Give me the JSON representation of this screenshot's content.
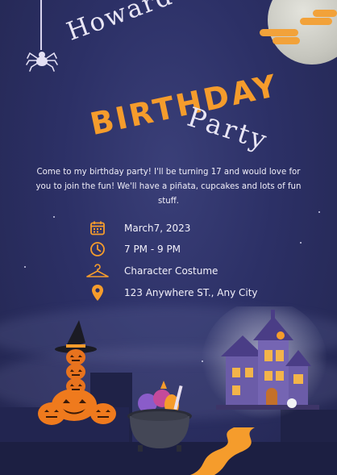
{
  "invite": {
    "name_line": "Howard's",
    "headline": "BIRTHDAY",
    "subline": "Party",
    "message": "Come to my birthday party! I'll be turning 17 and would love for you to join the fun! We'll have a piñata, cupcakes and lots of fun stuff."
  },
  "details": {
    "date": "March7, 2023",
    "time": "7 PM - 9 PM",
    "dress_code": "Character Costume",
    "address": "123 Anywhere ST., Any City"
  },
  "icons": {
    "date": "calendar-icon",
    "time": "clock-icon",
    "dress_code": "hanger-icon",
    "address": "location-pin-icon"
  },
  "colors": {
    "background": "#2c3066",
    "accent": "#f59c2c",
    "text": "#f0eef8"
  }
}
